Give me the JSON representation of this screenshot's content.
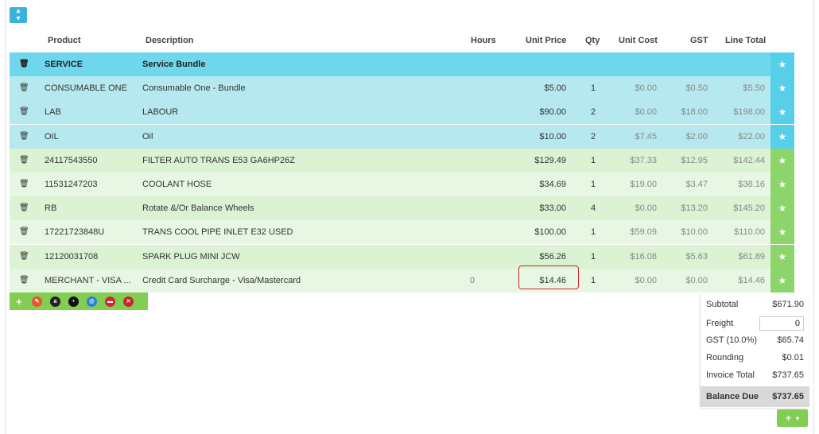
{
  "toolbar_top": {
    "sort_icon": "sort-icon"
  },
  "columns": {
    "product": "Product",
    "description": "Description",
    "hours": "Hours",
    "unit_price": "Unit Price",
    "qty": "Qty",
    "unit_cost": "Unit Cost",
    "gst": "GST",
    "line_total": "Line Total"
  },
  "colors": {
    "service_header": "#6fd7ec",
    "service_line": "#b5e9ef",
    "green_line_a": "#dbf2d3",
    "green_line_b": "#e8f7e3",
    "star_blue": "#58cfe8",
    "star_green": "#8dd56a",
    "toolbar_green": "#82cd54",
    "highlight": "#d4262b"
  },
  "rows": [
    {
      "product": "SERVICE",
      "description": "Service Bundle",
      "hours": "",
      "unit_price": "",
      "qty": "",
      "unit_cost": "",
      "gst": "",
      "line_total": "",
      "style": "header"
    },
    {
      "product": "CONSUMABLE ONE",
      "description": "Consumable One - Bundle",
      "hours": "",
      "unit_price": "$5.00",
      "qty": "1",
      "unit_cost": "$0.00",
      "gst": "$0.50",
      "line_total": "$5.50",
      "style": "service"
    },
    {
      "product": "LAB",
      "description": "LABOUR",
      "hours": "",
      "unit_price": "$90.00",
      "qty": "2",
      "unit_cost": "$0.00",
      "gst": "$18.00",
      "line_total": "$198.00",
      "style": "service"
    },
    {
      "product": "OIL",
      "description": "Oil",
      "hours": "",
      "unit_price": "$10.00",
      "qty": "2",
      "unit_cost": "$7.45",
      "gst": "$2.00",
      "line_total": "$22.00",
      "style": "service"
    },
    {
      "product": "24117543550",
      "description": "FILTER AUTO TRANS E53 GA6HP26Z",
      "hours": "",
      "unit_price": "$129.49",
      "qty": "1",
      "unit_cost": "$37.33",
      "gst": "$12.95",
      "line_total": "$142.44",
      "style": "a"
    },
    {
      "product": "11531247203",
      "description": "COOLANT HOSE",
      "hours": "",
      "unit_price": "$34.69",
      "qty": "1",
      "unit_cost": "$19.00",
      "gst": "$3.47",
      "line_total": "$38.16",
      "style": "b"
    },
    {
      "product": "RB",
      "description": "Rotate &/Or Balance Wheels",
      "hours": "",
      "unit_price": "$33.00",
      "qty": "4",
      "unit_cost": "$0.00",
      "gst": "$13.20",
      "line_total": "$145.20",
      "style": "a"
    },
    {
      "product": "17221723848U",
      "description": "TRANS COOL PIPE INLET E32 USED",
      "hours": "",
      "unit_price": "$100.00",
      "qty": "1",
      "unit_cost": "$59.09",
      "gst": "$10.00",
      "line_total": "$110.00",
      "style": "b"
    },
    {
      "product": "12120031708",
      "description": "SPARK PLUG MINI JCW",
      "hours": "",
      "unit_price": "$56.26",
      "qty": "1",
      "unit_cost": "$16.08",
      "gst": "$5.63",
      "line_total": "$61.89",
      "style": "a"
    },
    {
      "product": "MERCHANT - VISA ...",
      "description": "Credit Card Surcharge - Visa/Mastercard",
      "hours": "0",
      "unit_price": "$14.46",
      "qty": "1",
      "unit_cost": "$0.00",
      "gst": "$0.00",
      "line_total": "$14.46",
      "style": "b"
    }
  ],
  "bottom_toolbar": {
    "icons": [
      {
        "name": "add-line-icon",
        "symbol": "+",
        "color": "#82cd54"
      },
      {
        "name": "no-pencil-icon",
        "symbol": "✎",
        "color": "#e8542c"
      },
      {
        "name": "supplier-a-icon",
        "symbol": "a",
        "color": "#222222"
      },
      {
        "name": "supplier-b-icon",
        "symbol": "•",
        "color": "#111111"
      },
      {
        "name": "supplier-c-icon",
        "symbol": "@",
        "color": "#2a7fd4"
      },
      {
        "name": "supplier-d-icon",
        "symbol": "▬",
        "color": "#d4262b"
      },
      {
        "name": "supplier-e-icon",
        "symbol": "✕",
        "color": "#c4262b"
      }
    ]
  },
  "totals": {
    "subtotal_label": "Subtotal",
    "subtotal_value": "$671.90",
    "freight_label": "Freight",
    "freight_value": "0",
    "gst_label": "GST (10.0%)",
    "gst_value": "$65.74",
    "rounding_label": "Rounding",
    "rounding_value": "$0.01",
    "invoice_total_label": "Invoice Total",
    "invoice_total_value": "$737.65",
    "balance_due_label": "Balance Due",
    "balance_due_value": "$737.65"
  }
}
